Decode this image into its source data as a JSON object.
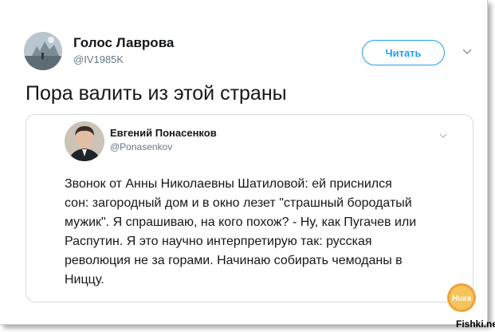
{
  "tweet": {
    "author_name": "Голос Лаврова",
    "author_handle": "@IV1985K",
    "follow_label": "Читать",
    "text": "Пора валить из этой страны"
  },
  "quoted": {
    "author_name": "Евгений Понасенков",
    "author_handle": "@Ponasenkov",
    "lines": [
      "Звонок от Анны Николаевны Шатиловой: ей приснился",
      "сон: загородный дом и в окно лезет \"страшный бородатый",
      "мужик\". Я спрашиваю, на кого похож? - Ну, как Пугачев или",
      "Распутин.  Я это научно интерпретирую так: русская",
      "революция не за горами. Начинаю собирать чемоданы в",
      "Ниццу."
    ]
  },
  "watermark": {
    "badge_text": "Ника",
    "site": "Fishki.net"
  },
  "colors": {
    "accent": "#1da1f2",
    "secondary_text": "#657786",
    "card_border": "#d3dde4"
  },
  "icons": [
    "chevron-down-icon"
  ]
}
